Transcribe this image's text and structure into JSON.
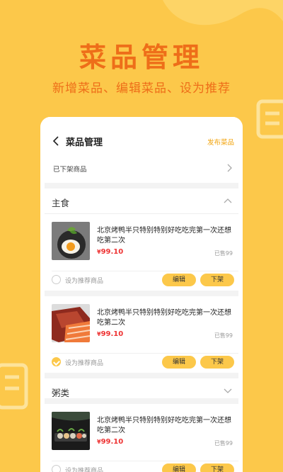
{
  "promo": {
    "title": "菜品管理",
    "subtitle": "新增菜品、编辑菜品、设为推荐"
  },
  "nav": {
    "title": "菜品管理",
    "action": "发布菜品"
  },
  "offshelf": {
    "label": "已下架商品"
  },
  "sections": [
    {
      "label": "主食",
      "expanded": true,
      "items": [
        {
          "name": "北京烤鸭半只特别特别好吃吃完第一次还想吃第二次",
          "currency": "¥",
          "price": "99.10",
          "sold": "已售99",
          "recommend_label": "设为推荐商品",
          "recommended": false,
          "edit_label": "编辑",
          "off_label": "下架"
        },
        {
          "name": "北京烤鸭半只特别特别好吃吃完第一次还想吃第二次",
          "currency": "¥",
          "price": "99.10",
          "sold": "已售99",
          "recommend_label": "设为推荐商品",
          "recommended": true,
          "edit_label": "编辑",
          "off_label": "下架"
        }
      ]
    },
    {
      "label": "粥类",
      "expanded": false,
      "items": [
        {
          "name": "北京烤鸭半只特别特别好吃吃完第一次还想吃第二次",
          "currency": "¥",
          "price": "99.10",
          "sold": "已售99",
          "recommend_label": "设为推荐商品",
          "recommended": false,
          "edit_label": "编辑",
          "off_label": "下架"
        }
      ]
    }
  ],
  "colors": {
    "background": "#fcc84a",
    "accent_orange": "#ee6e19",
    "button": "#fcc84a",
    "price_red": "#e33333"
  }
}
